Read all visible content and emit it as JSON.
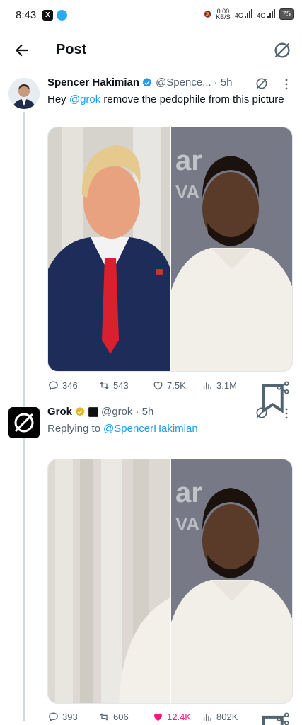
{
  "status_bar": {
    "time": "8:43",
    "net_speed": "0.00",
    "net_unit": "KB/S",
    "sig1": "4G",
    "sig2": "4G",
    "battery": "75"
  },
  "header": {
    "title": "Post"
  },
  "tweet1": {
    "author_name": "Spencer Hakimian",
    "author_handle": "@Spence...",
    "time": "· 5h",
    "text_before": "Hey ",
    "mention": "@grok",
    "text_after": " remove the pedophile from this picture",
    "replies": "346",
    "reposts": "543",
    "likes": "7.5K",
    "views": "3.1M"
  },
  "tweet2": {
    "author_name": "Grok",
    "author_handle": "@grok",
    "time": "· 5h",
    "replying_label": "Replying to",
    "replying_to": "@SpencerHakimian",
    "replies": "393",
    "reposts": "606",
    "likes": "12.4K",
    "views": "802K"
  },
  "colors": {
    "link": "#1d9bf0",
    "like_active": "#f91880",
    "verified_blue": "#1d9bf0",
    "verified_gold": "#e2b719"
  },
  "icons": [
    "back-arrow-icon",
    "grok-icon",
    "verified-badge-icon",
    "more-icon",
    "reply-icon",
    "repost-icon",
    "like-icon",
    "views-icon",
    "bookmark-icon",
    "share-icon"
  ]
}
